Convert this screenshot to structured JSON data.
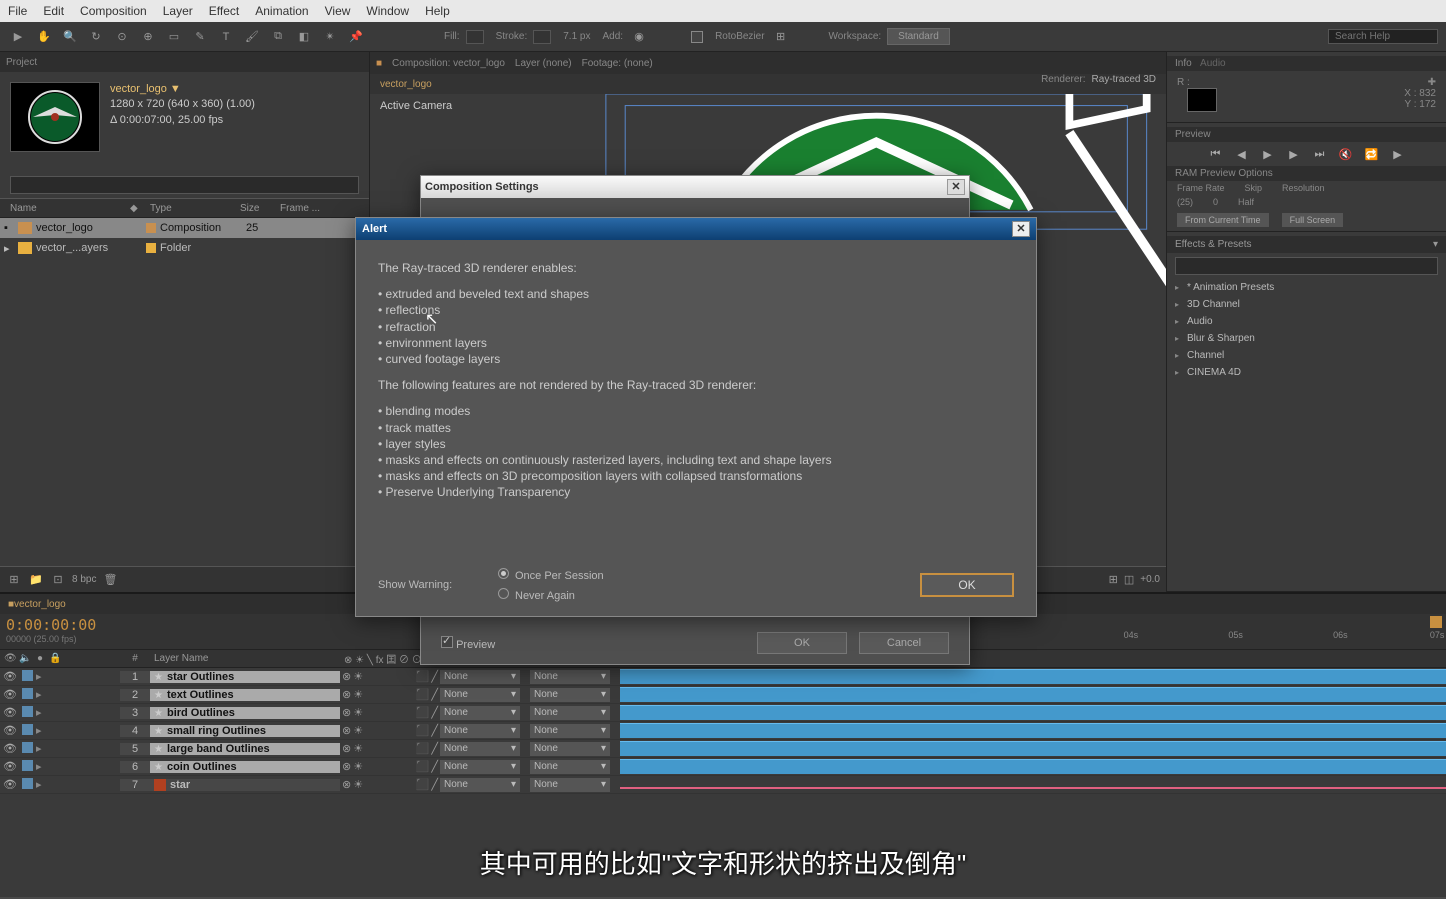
{
  "menubar": [
    "File",
    "Edit",
    "Composition",
    "Layer",
    "Effect",
    "Animation",
    "View",
    "Window",
    "Help"
  ],
  "toolbar": {
    "fill": "Fill:",
    "stroke": "Stroke:",
    "strokeVal": "7.1 px",
    "add": "Add:",
    "rotobezier": "RotoBezier",
    "workspace_lbl": "Workspace:",
    "workspace_val": "Standard",
    "search_ph": "Search Help"
  },
  "project": {
    "tab": "Project",
    "name": "vector_logo ▼",
    "dims": "1280 x 720  (640 x 360) (1.00)",
    "dur": "Δ 0:00:07:00, 25.00 fps",
    "cols": {
      "name": "Name",
      "tag": "◆",
      "type": "Type",
      "size": "Size",
      "frame": "Frame ..."
    },
    "items": [
      {
        "name": "vector_logo",
        "type": "Composition",
        "size": "25",
        "icon": "comp",
        "sel": true
      },
      {
        "name": "vector_...ayers",
        "type": "Folder",
        "size": "",
        "icon": "folder",
        "sel": false
      }
    ],
    "bpc": "8 bpc"
  },
  "compPanel": {
    "tabs": [
      "Composition: vector_logo",
      "Layer (none)",
      "Footage: (none)"
    ],
    "subtab": "vector_logo",
    "renderer_lbl": "Renderer:",
    "renderer_val": "Ray-traced 3D",
    "activeCam": "Active Camera"
  },
  "info": {
    "tab": "Info",
    "r": "R :",
    "x": "X : 832",
    "y": "Y : 172"
  },
  "preview": {
    "tab": "Preview",
    "opts": "RAM Preview Options",
    "labels": [
      "Frame Rate",
      "Skip",
      "Resolution"
    ],
    "vals": [
      "(25)",
      "0",
      "Half"
    ],
    "btn1": "From Current Time",
    "btn2": "Full Screen"
  },
  "effects": {
    "tab": "Effects & Presets",
    "items": [
      "* Animation Presets",
      "3D Channel",
      "Audio",
      "Blur & Sharpen",
      "Channel",
      "CINEMA 4D"
    ]
  },
  "timeline": {
    "tab": "vector_logo",
    "timecode": "0:00:00:00",
    "sub": "00000 (25.00 fps)",
    "colHead": {
      "num": "#",
      "layer": "Layer Name"
    },
    "switchHead": "⊗ ☀ ╲ fx 囯 ⊘ ⊙ ◐",
    "ticks": [
      "04s",
      "05s",
      "06s",
      "07s"
    ],
    "layers": [
      {
        "n": 1,
        "name": "star Outlines",
        "star": true,
        "mode": "None",
        "blue": true,
        "sel": true
      },
      {
        "n": 2,
        "name": "text Outlines",
        "star": true,
        "mode": "None",
        "blue": true,
        "sel": true
      },
      {
        "n": 3,
        "name": "bird Outlines",
        "star": true,
        "mode": "None",
        "blue": true,
        "sel": true
      },
      {
        "n": 4,
        "name": "small ring Outlines",
        "star": true,
        "mode": "None",
        "blue": true,
        "sel": true
      },
      {
        "n": 5,
        "name": "large band Outlines",
        "star": true,
        "mode": "None",
        "blue": true,
        "sel": true
      },
      {
        "n": 6,
        "name": "coin Outlines",
        "star": true,
        "mode": "None",
        "blue": true,
        "sel": true
      },
      {
        "n": 7,
        "name": "star",
        "star": false,
        "mode": "None",
        "blue": false,
        "sel": false
      }
    ]
  },
  "compSettings": {
    "title": "Composition Settings",
    "preview": "Preview",
    "ok": "OK",
    "cancel": "Cancel"
  },
  "alert": {
    "title": "Alert",
    "intro": "The Ray-traced 3D renderer enables:",
    "enables": [
      "extruded and beveled text and shapes",
      "reflections",
      "refraction",
      "environment layers",
      "curved footage layers"
    ],
    "notIntro": "The following features are not rendered by the Ray-traced 3D renderer:",
    "nots": [
      "blending modes",
      "track mattes",
      "layer styles",
      "masks and effects on continuously rasterized layers, including text and shape layers",
      "masks and effects on 3D precomposition layers with collapsed transformations",
      "Preserve Underlying Transparency"
    ],
    "showWarn": "Show Warning:",
    "r1": "Once Per Session",
    "r2": "Never Again",
    "ok": "OK"
  },
  "subtitle": "其中可用的比如\"文字和形状的挤出及倒角\""
}
